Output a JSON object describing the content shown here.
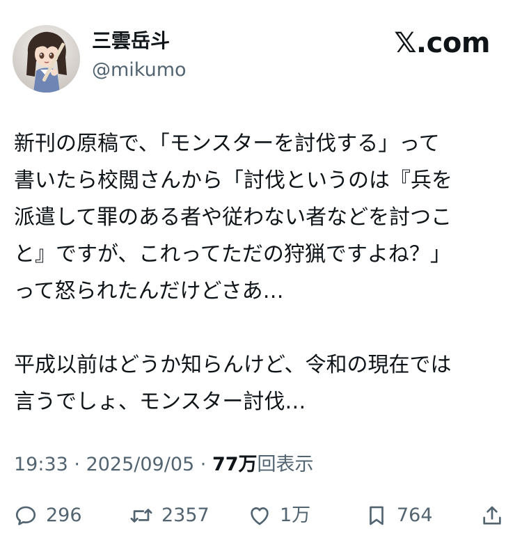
{
  "author": {
    "display_name": "三雲岳斗",
    "handle": "@mikumo",
    "avatar": "anime-figure-avatar"
  },
  "source_label": "𝕏.com",
  "tweet": {
    "paragraphs": [
      [
        "新刊の原稿で、「モンスターを討伐する」って",
        "書いたら校閲さんから「討伐というのは『兵を",
        "派遣して罪のある者や従わない者などを討つこ",
        "と』ですが、これってただの狩猟ですよね？」",
        "って怒られたんだけどさあ…"
      ],
      [
        "平成以前はどうか知らんけど、令和の現在では",
        "言うでしょ、モンスター討伐…"
      ]
    ]
  },
  "meta": {
    "time": "19:33",
    "separator": " · ",
    "date": "2025/09/05",
    "views_count": "77万",
    "views_label": "回表示"
  },
  "actions": {
    "replies": {
      "icon": "reply-icon",
      "count": "296"
    },
    "retweets": {
      "icon": "retweet-icon",
      "count": "2357"
    },
    "likes": {
      "icon": "heart-icon",
      "count": "1万"
    },
    "bookmarks": {
      "icon": "bookmark-icon",
      "count": "764"
    },
    "share": {
      "icon": "share-icon"
    }
  },
  "colors": {
    "text_primary": "#0f1419",
    "text_secondary": "#536471",
    "background": "#ffffff"
  }
}
